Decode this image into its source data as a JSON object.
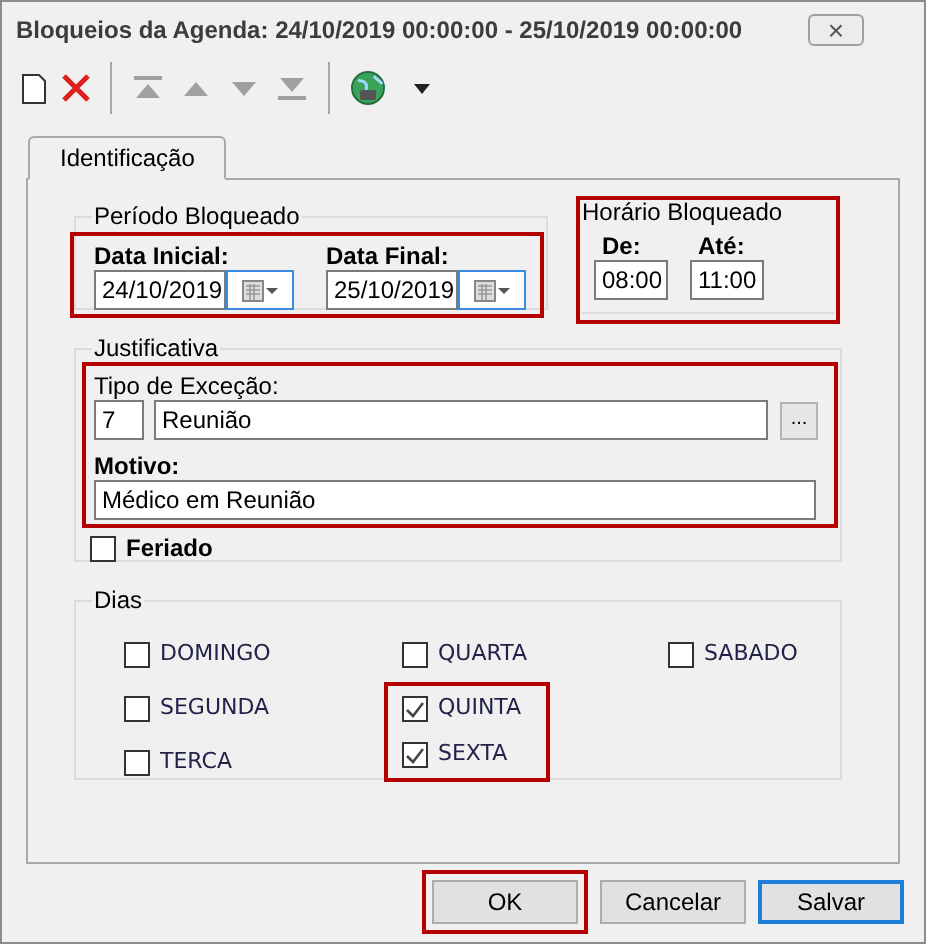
{
  "window": {
    "title": "Bloqueios da Agenda: 24/10/2019 00:00:00 - 25/10/2019 00:00:00",
    "close": "×"
  },
  "toolbar": [
    {
      "kind": "new",
      "disabled": false
    },
    {
      "kind": "delete",
      "disabled": false
    },
    {
      "kind": "separator"
    },
    {
      "kind": "first",
      "disabled": true
    },
    {
      "kind": "previous",
      "disabled": true
    },
    {
      "kind": "next",
      "disabled": true
    },
    {
      "kind": "last",
      "disabled": true
    },
    {
      "kind": "separator"
    },
    {
      "kind": "globe",
      "disabled": false
    },
    {
      "kind": "dropdown",
      "disabled": false
    }
  ],
  "tabs": [
    {
      "label": "Identificação",
      "selected": true
    }
  ],
  "periodo": {
    "legend": "Período Bloqueado",
    "highlighted": true,
    "fields": [
      {
        "label": "Data Inicial:",
        "value": "24/10/2019"
      },
      {
        "label": "Data Final:",
        "value": "25/10/2019"
      }
    ]
  },
  "horario": {
    "legend": "Horário Bloqueado",
    "highlighted": true,
    "fields": [
      {
        "label": "De:",
        "value": "08:00"
      },
      {
        "label": "Até:",
        "value": "11:00"
      }
    ]
  },
  "justificativa": {
    "legend": "Justificativa",
    "highlighted": true,
    "tipo_label": "Tipo de Exceção:",
    "code": "7",
    "tipo_value": "Reunião",
    "browse": "...",
    "motivo_label": "Motivo:",
    "motivo_value": "Médico em Reunião"
  },
  "feriado": {
    "label": "Feriado",
    "checked": false
  },
  "dias": {
    "legend": "Dias",
    "columns": [
      [
        {
          "label": "DOMINGO",
          "checked": false,
          "highlighted": false
        },
        {
          "label": "SEGUNDA",
          "checked": false,
          "highlighted": false
        },
        {
          "label": "TERCA",
          "checked": false,
          "highlighted": false
        }
      ],
      [
        {
          "label": "QUARTA",
          "checked": false,
          "highlighted": false
        },
        {
          "label": "QUINTA",
          "checked": true,
          "highlighted": true
        },
        {
          "label": "SEXTA",
          "checked": true,
          "highlighted": true
        }
      ],
      [
        {
          "label": "SABADO",
          "checked": false,
          "highlighted": false
        }
      ]
    ]
  },
  "buttons": [
    {
      "label": "OK",
      "highlighted": true,
      "focused": false
    },
    {
      "label": "Cancelar",
      "highlighted": false,
      "focused": false
    },
    {
      "label": "Salvar",
      "highlighted": false,
      "focused": true
    }
  ]
}
